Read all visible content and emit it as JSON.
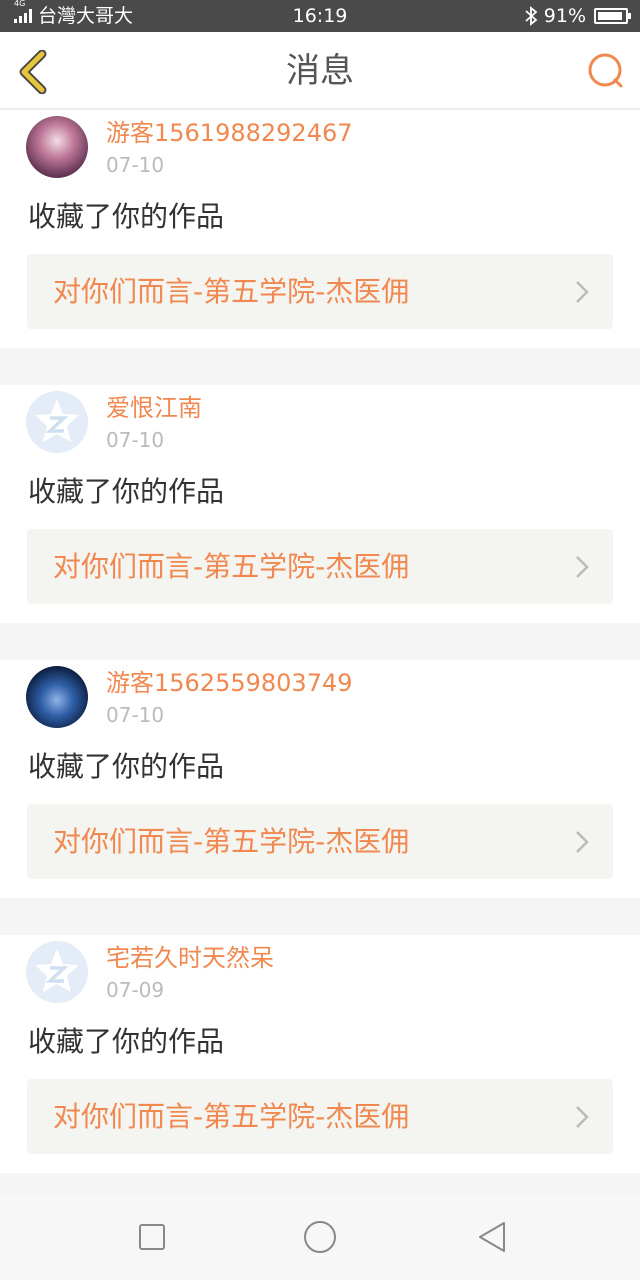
{
  "status_bar": {
    "network": "4G",
    "carrier": "台灣大哥大",
    "time": "16:19",
    "battery": "91%",
    "battery_level": 0.91
  },
  "header": {
    "title": "消息",
    "back_icon": "chevron-left-icon",
    "search_icon": "search-icon"
  },
  "colors": {
    "accent": "#f0884f",
    "back_icon": "#e6c63a",
    "text_primary": "#333333",
    "text_secondary": "#bbbbbb",
    "card_link_bg": "#f4f4f0"
  },
  "notifications": [
    {
      "user": "游客1561988292467",
      "date": "07-10",
      "action": "收藏了你的作品",
      "work_title": "对你们而言-第五学院-杰医佣",
      "avatar": "photo"
    },
    {
      "user": "爱恨江南",
      "date": "07-10",
      "action": "收藏了你的作品",
      "work_title": "对你们而言-第五学院-杰医佣",
      "avatar": "default"
    },
    {
      "user": "游客1562559803749",
      "date": "07-10",
      "action": "收藏了你的作品",
      "work_title": "对你们而言-第五学院-杰医佣",
      "avatar": "photo"
    },
    {
      "user": "宅若久时天然呆",
      "date": "07-09",
      "action": "收藏了你的作品",
      "work_title": "对你们而言-第五学院-杰医佣",
      "avatar": "default"
    }
  ],
  "nav_bar": {
    "recents_icon": "square-icon",
    "home_icon": "circle-icon",
    "back_icon": "triangle-back-icon"
  }
}
